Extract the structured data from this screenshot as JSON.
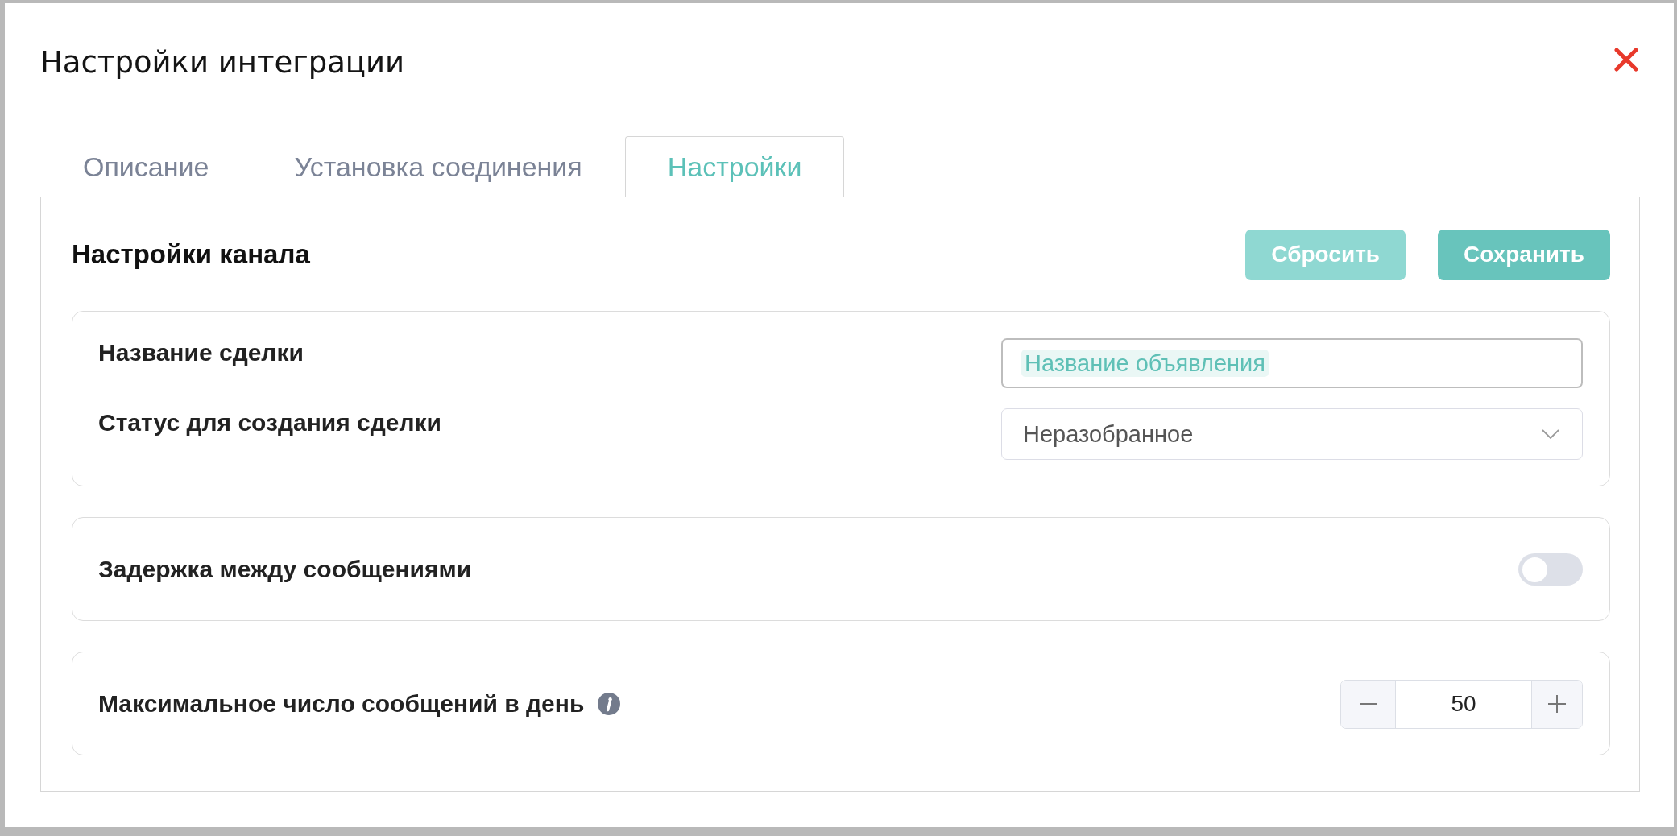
{
  "dialog": {
    "title": "Настройки интеграции"
  },
  "tabs": [
    {
      "label": "Описание",
      "selected": false
    },
    {
      "label": "Установка соединения",
      "selected": false
    },
    {
      "label": "Настройки",
      "selected": true
    }
  ],
  "section": {
    "title": "Настройки канала",
    "buttons": [
      {
        "label": "Сбросить",
        "disabled": true
      },
      {
        "label": "Сохранить",
        "disabled": false
      }
    ]
  },
  "cards": [
    {
      "rows": [
        {
          "kind": "tag_input",
          "label": "Название сделки",
          "tags": [
            "Название объявления"
          ]
        },
        {
          "kind": "select",
          "label": "Статус для создания сделки",
          "value": "Неразобранное"
        }
      ]
    },
    {
      "rows": [
        {
          "kind": "toggle",
          "label": "Задержка между сообщениями",
          "on": false
        }
      ]
    },
    {
      "rows": [
        {
          "kind": "stepper",
          "label": "Максимальное число сообщений в день",
          "info": true,
          "value": "50"
        }
      ]
    }
  ]
}
